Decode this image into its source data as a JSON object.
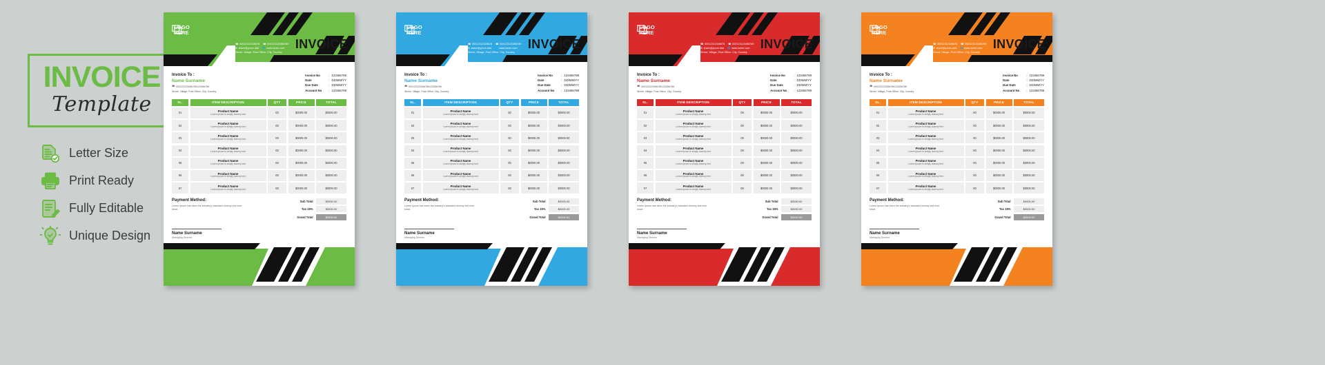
{
  "promo": {
    "title": "INVOICE",
    "subtitle": "Template",
    "accent": "#6cbb45",
    "features": [
      {
        "icon": "document-check-icon",
        "label": "Letter Size"
      },
      {
        "icon": "printer-icon",
        "label": "Print Ready"
      },
      {
        "icon": "document-edit-icon",
        "label": "Fully Editable"
      },
      {
        "icon": "lightbulb-check-icon",
        "label": "Unique Design"
      }
    ]
  },
  "card_common": {
    "logo_line1": "LOGO",
    "logo_line2": "HERE",
    "logo_icon": "logo-placeholder-icon",
    "invoice_word": "INVOICE",
    "contact": {
      "phone1": "00012312345678",
      "phone2": "000123123456789",
      "email": "share@youm.ddd",
      "web": "www.lorem.com",
      "address": "Street, Village, Post Office, City, Country",
      "phone_icon": "phone-icon",
      "email_icon": "envelope-icon",
      "web_icon": "globe-icon",
      "address_icon": "location-icon"
    },
    "bill_to_label": "Invoice To :",
    "bill_to_name": "Name Surname",
    "bill_to_phone": "000123123456789123456789",
    "bill_to_address": "Street, Village, Post Office, City, Country",
    "meta_rows": [
      {
        "key": "Invoice No",
        "value": "123456789"
      },
      {
        "key": "Date",
        "value": "DD/MM/YY"
      },
      {
        "key": "Due Date",
        "value": "DD/MM/YY"
      },
      {
        "key": "Account No",
        "value": "123456789"
      }
    ],
    "meta_sep": ":",
    "table_headers": [
      "SL.",
      "ITEM DESCRIPTION",
      "QTY",
      "PRICE",
      "TOTAL"
    ],
    "table_rows": [
      {
        "sl": "01",
        "name": "Product Name",
        "desc": "Lorem Ipsum is simply dummy text",
        "qty": "00",
        "price": "$0000.00",
        "total": "$0000.00"
      },
      {
        "sl": "02",
        "name": "Product Name",
        "desc": "Lorem Ipsum is simply dummy text",
        "qty": "00",
        "price": "$0000.00",
        "total": "$0000.00"
      },
      {
        "sl": "03",
        "name": "Product Name",
        "desc": "Lorem Ipsum is simply dummy text",
        "qty": "00",
        "price": "$0000.00",
        "total": "$0000.00"
      },
      {
        "sl": "04",
        "name": "Product Name",
        "desc": "Lorem Ipsum is simply dummy text",
        "qty": "00",
        "price": "$0000.00",
        "total": "$0000.00"
      },
      {
        "sl": "05",
        "name": "Product Name",
        "desc": "Lorem Ipsum is simply dummy text",
        "qty": "00",
        "price": "$0000.00",
        "total": "$0000.00"
      },
      {
        "sl": "06",
        "name": "Product Name",
        "desc": "Lorem Ipsum is simply dummy text",
        "qty": "00",
        "price": "$0000.00",
        "total": "$0000.00"
      },
      {
        "sl": "07",
        "name": "Product Name",
        "desc": "Lorem Ipsum is simply dummy text",
        "qty": "00",
        "price": "$0000.00",
        "total": "$0000.00"
      }
    ],
    "payment_title": "Payment Method:",
    "payment_desc": "Lorem Ipsum has been the industry's standard dummy text ever since.",
    "summary": [
      {
        "label": "Sub Total",
        "value": "$0000.00",
        "emphasis": false
      },
      {
        "label": "Tax 15%",
        "value": "$0000.00",
        "emphasis": false
      },
      {
        "label": "Grand Total",
        "value": "$0000.00",
        "emphasis": true
      }
    ],
    "sign_name": "Name Surname",
    "sign_role": "Managing Director"
  },
  "cards": [
    {
      "id": "invoice-card-green",
      "variant": "green",
      "color": "#6cbb45"
    },
    {
      "id": "invoice-card-blue",
      "variant": "blue",
      "color": "#32a8e0"
    },
    {
      "id": "invoice-card-red",
      "variant": "red",
      "color": "#d92b2b"
    },
    {
      "id": "invoice-card-orange",
      "variant": "orange",
      "color": "#f58220"
    }
  ]
}
